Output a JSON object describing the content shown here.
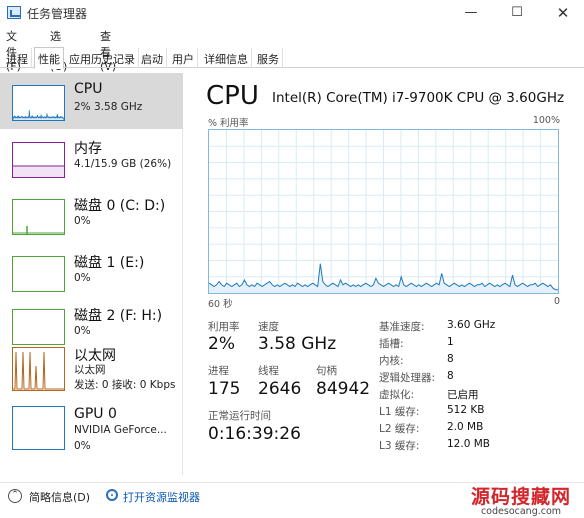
{
  "window": {
    "title": "任务管理器",
    "min_glyph": "—",
    "max_glyph": "☐",
    "close_glyph": "✕"
  },
  "menu": [
    "文件(F)",
    "选项(O)",
    "查看(V)"
  ],
  "tabs": [
    "进程",
    "性能",
    "应用历史记录",
    "启动",
    "用户",
    "详细信息",
    "服务"
  ],
  "sidebar": {
    "items": [
      {
        "title": "CPU",
        "sub": "2% 3.58 GHz",
        "sub2": "",
        "color": "#1e78be"
      },
      {
        "title": "内存",
        "sub": "4.1/15.9 GB (26%)",
        "sub2": "",
        "color": "#8b1e9b"
      },
      {
        "title": "磁盘 0 (C: D:)",
        "sub": "0%",
        "sub2": "",
        "color": "#4da53a"
      },
      {
        "title": "磁盘 1 (E:)",
        "sub": "0%",
        "sub2": "",
        "color": "#4da53a"
      },
      {
        "title": "磁盘 2 (F: H:)",
        "sub": "0%",
        "sub2": "",
        "color": "#4da53a"
      },
      {
        "title": "以太网",
        "sub": "以太网",
        "sub2": "发送: 0 接收: 0 Kbps",
        "color": "#b5651d"
      },
      {
        "title": "GPU 0",
        "sub": "NVIDIA GeForce...",
        "sub2": "0%",
        "color": "#1e78be"
      }
    ]
  },
  "main": {
    "title": "CPU",
    "cpu_name": "Intel(R) Core(TM) i7-9700K CPU @ 3.60GHz",
    "graph": {
      "y_label": "% 利用率",
      "y_max_label": "100%",
      "x_left_label": "60 秒",
      "x_right_label": "0",
      "color": "#1e78be",
      "utilization_percent": [
        6,
        5,
        4,
        5,
        7,
        5,
        4,
        6,
        5,
        4,
        5,
        6,
        4,
        5,
        8,
        5,
        4,
        5,
        4,
        6,
        5,
        4,
        5,
        6,
        7,
        5,
        4,
        5,
        4,
        5,
        6,
        5,
        4,
        5,
        4,
        6,
        5,
        4,
        5,
        4,
        5,
        6,
        5,
        4,
        18,
        7,
        5,
        4,
        5,
        6,
        5,
        4,
        8,
        5,
        6,
        5,
        4,
        5,
        4,
        5,
        4,
        5,
        6,
        5,
        4,
        5,
        9,
        6,
        5,
        4,
        5,
        6,
        5,
        4,
        5,
        4,
        10,
        5,
        4,
        5,
        6,
        5,
        4,
        5,
        4,
        5,
        6,
        5,
        4,
        5,
        6,
        5,
        12,
        6,
        5,
        4,
        5,
        6,
        5,
        4,
        5,
        4,
        5,
        6,
        5,
        4,
        5,
        5,
        6,
        4,
        5,
        6,
        5,
        4,
        5,
        4,
        5,
        6,
        5,
        4,
        11,
        5,
        4,
        5,
        6,
        5,
        4,
        5,
        5,
        6,
        4,
        5,
        6,
        5,
        4,
        5,
        3,
        2,
        2
      ]
    },
    "stats": {
      "utilization_label": "利用率",
      "utilization": "2%",
      "speed_label": "速度",
      "speed": "3.58 GHz",
      "processes_label": "进程",
      "processes": "175",
      "threads_label": "线程",
      "threads": "2646",
      "handles_label": "句柄",
      "handles": "84942",
      "uptime_label": "正常运行时间",
      "uptime": "0:16:39:26"
    },
    "details": [
      {
        "key": "基准速度:",
        "value": "3.60 GHz"
      },
      {
        "key": "插槽:",
        "value": "1"
      },
      {
        "key": "内核:",
        "value": "8"
      },
      {
        "key": "逻辑处理器:",
        "value": "8"
      },
      {
        "key": "虚拟化:",
        "value": "已启用"
      },
      {
        "key": "L1 缓存:",
        "value": "512 KB"
      },
      {
        "key": "L2 缓存:",
        "value": "2.0 MB"
      },
      {
        "key": "L3 缓存:",
        "value": "12.0 MB"
      }
    ]
  },
  "footer": {
    "less_glyph": "⌃",
    "less_label": "简略信息(D)",
    "monitor_label": "打开资源监视器"
  },
  "watermark": {
    "top": "源码搜藏网",
    "bottom": "codesocang.com"
  }
}
